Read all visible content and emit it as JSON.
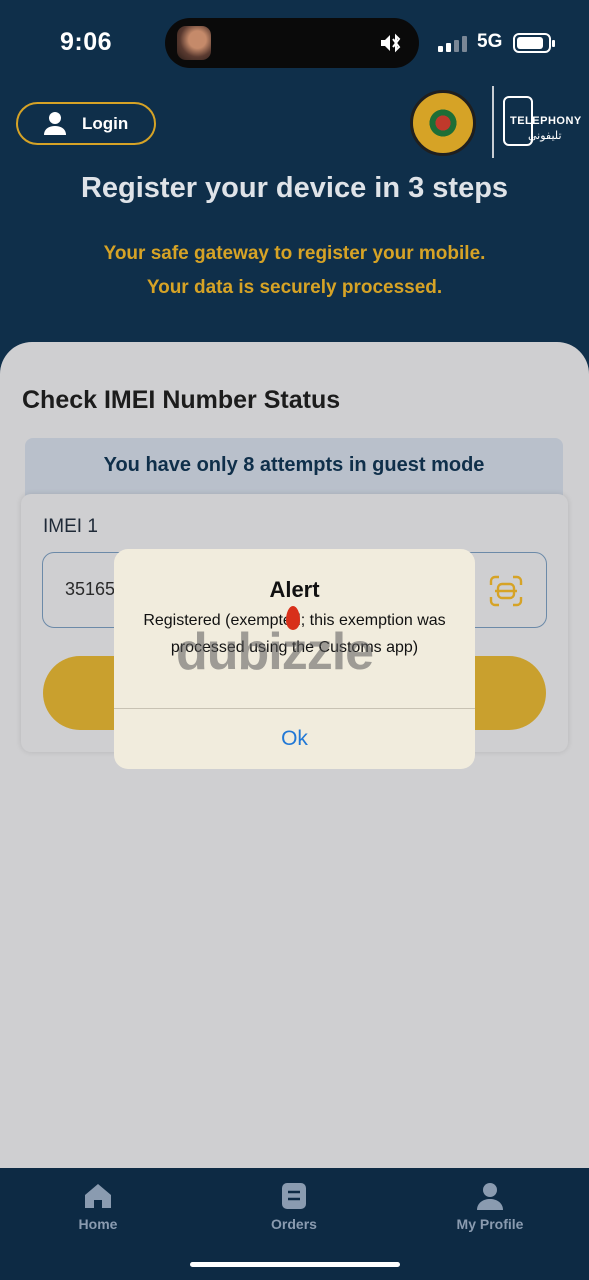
{
  "status": {
    "time": "9:06",
    "network": "5G"
  },
  "header": {
    "login_label": "Login",
    "headline": "Register your device in 3 steps",
    "subtitle_line1": "Your safe gateway to register your mobile.",
    "subtitle_line2": "Your data is securely processed.",
    "tele_logo_en": "TELEPHONY",
    "tele_logo_ar": "تليفوني"
  },
  "main": {
    "title": "Check IMEI Number Status",
    "attempts_banner": "You have only 8 attempts in guest mode",
    "imei_label": "IMEI 1",
    "imei_value": "35165",
    "scan_icon": "scan-icon"
  },
  "alert": {
    "title": "Alert",
    "message": "Registered (exempted; this exemption was processed using the Customs app)",
    "ok_label": "Ok"
  },
  "watermark": "dubizzle",
  "nav": {
    "items": [
      {
        "label": "Home",
        "icon": "home-icon"
      },
      {
        "label": "Orders",
        "icon": "orders-icon"
      },
      {
        "label": "My Profile",
        "icon": "profile-icon"
      }
    ]
  },
  "colors": {
    "navy": "#0f2f4a",
    "gold": "#d6a326",
    "link_blue": "#2178d6"
  }
}
